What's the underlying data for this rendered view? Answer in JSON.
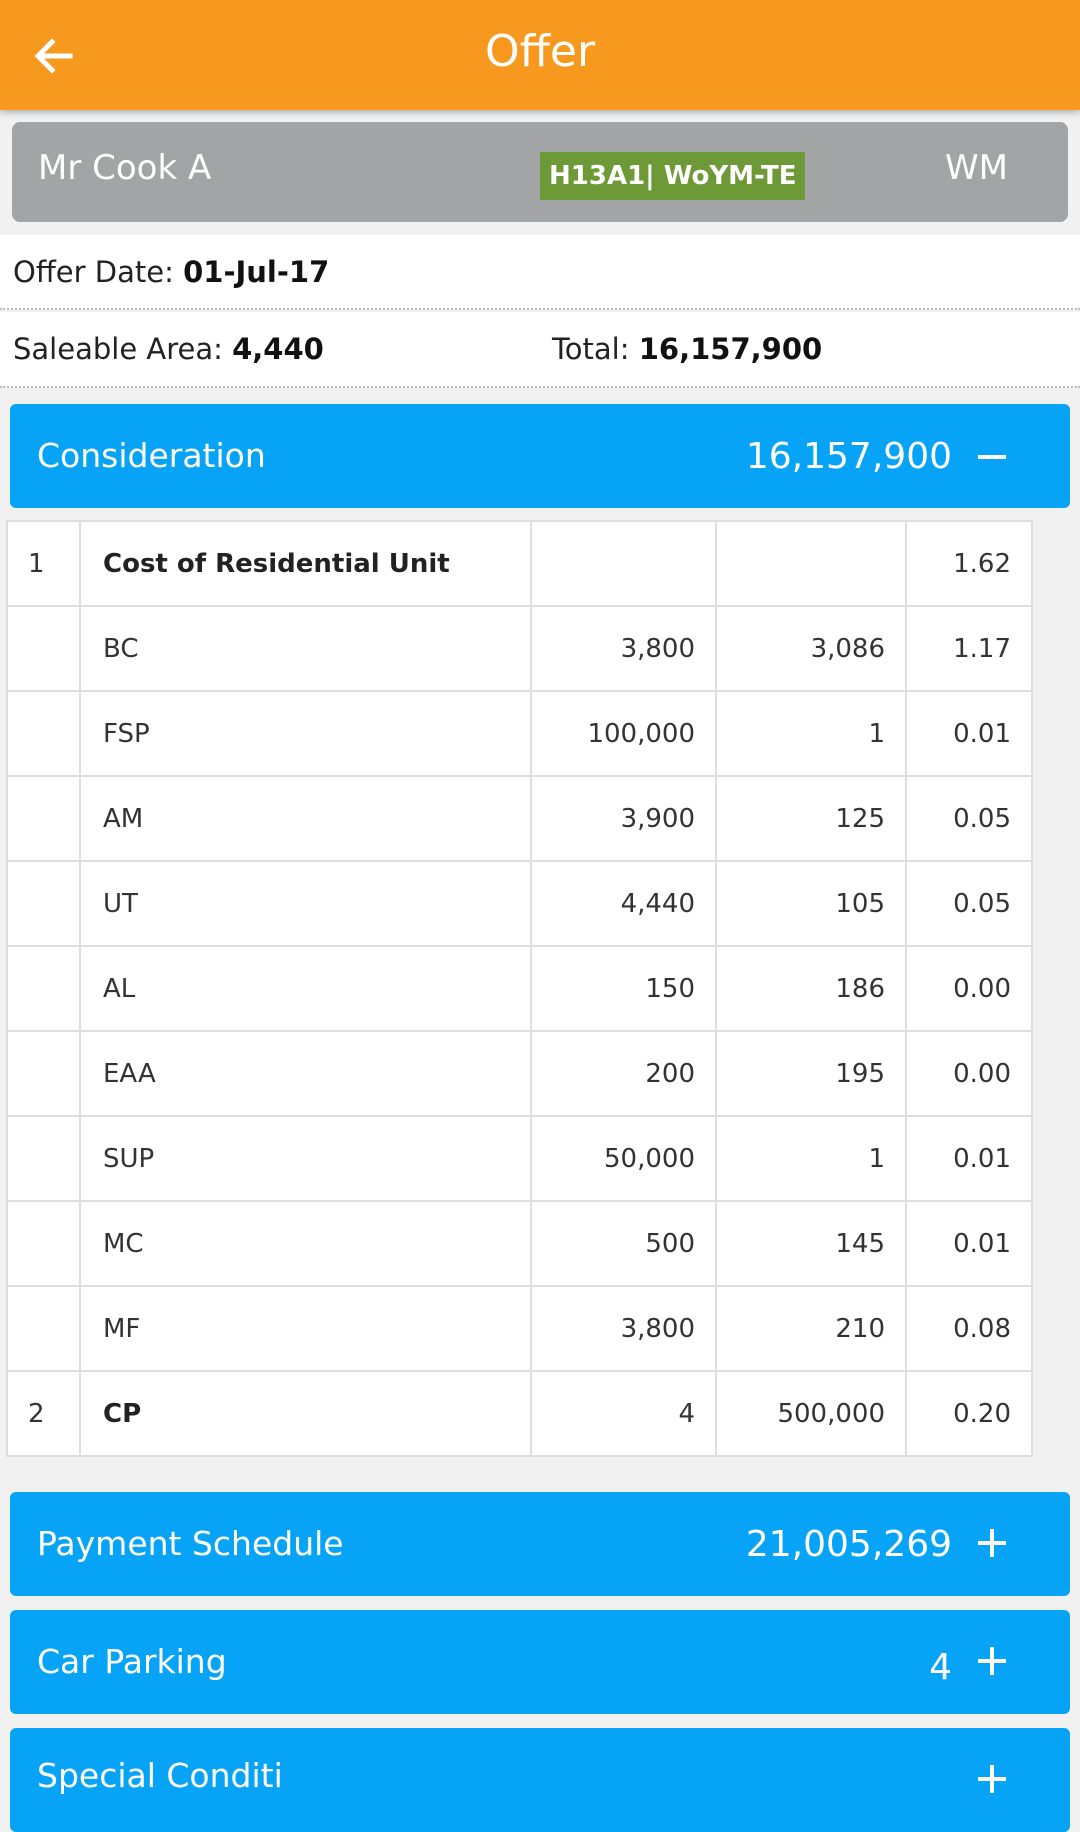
{
  "appbar": {
    "title": "Offer",
    "back_icon": "arrow-left-icon"
  },
  "customer": {
    "name": "Mr Cook A",
    "unit": "H13A1| WoYM-TE",
    "code": "WM"
  },
  "offer": {
    "date_label": "Offer Date:",
    "date_value": "01-Jul-17",
    "area_label": "Saleable Area:",
    "area_value": "4,440",
    "total_label": "Total:",
    "total_value": "16,157,900"
  },
  "sections": {
    "consideration": {
      "label": "Consideration",
      "value": "16,157,900",
      "toggle": "minus-icon"
    },
    "payment": {
      "label": "Payment Schedule",
      "value": "21,005,269",
      "toggle": "plus-icon"
    },
    "parking": {
      "label": "Car Parking",
      "value": "4",
      "toggle": "plus-icon"
    },
    "special": {
      "label": "Special Conditi",
      "toggle": "plus-icon"
    }
  },
  "consideration_rows": [
    {
      "idx": "1",
      "name": "Cost of Residential Unit",
      "a": "",
      "b": "",
      "c": "1.62",
      "bold": true
    },
    {
      "idx": "",
      "name": "BC",
      "a": "3,800",
      "b": "3,086",
      "c": "1.17"
    },
    {
      "idx": "",
      "name": "FSP",
      "a": "100,000",
      "b": "1",
      "c": "0.01"
    },
    {
      "idx": "",
      "name": "AM",
      "a": "3,900",
      "b": "125",
      "c": "0.05"
    },
    {
      "idx": "",
      "name": "UT",
      "a": "4,440",
      "b": "105",
      "c": "0.05"
    },
    {
      "idx": "",
      "name": "AL",
      "a": "150",
      "b": "186",
      "c": "0.00"
    },
    {
      "idx": "",
      "name": "EAA",
      "a": "200",
      "b": "195",
      "c": "0.00"
    },
    {
      "idx": "",
      "name": "SUP",
      "a": "50,000",
      "b": "1",
      "c": "0.01"
    },
    {
      "idx": "",
      "name": "MC",
      "a": "500",
      "b": "145",
      "c": "0.01"
    },
    {
      "idx": "",
      "name": "MF",
      "a": "3,800",
      "b": "210",
      "c": "0.08"
    },
    {
      "idx": "2",
      "name": "CP",
      "a": "4",
      "b": "500,000",
      "c": "0.20",
      "bold": true
    }
  ]
}
